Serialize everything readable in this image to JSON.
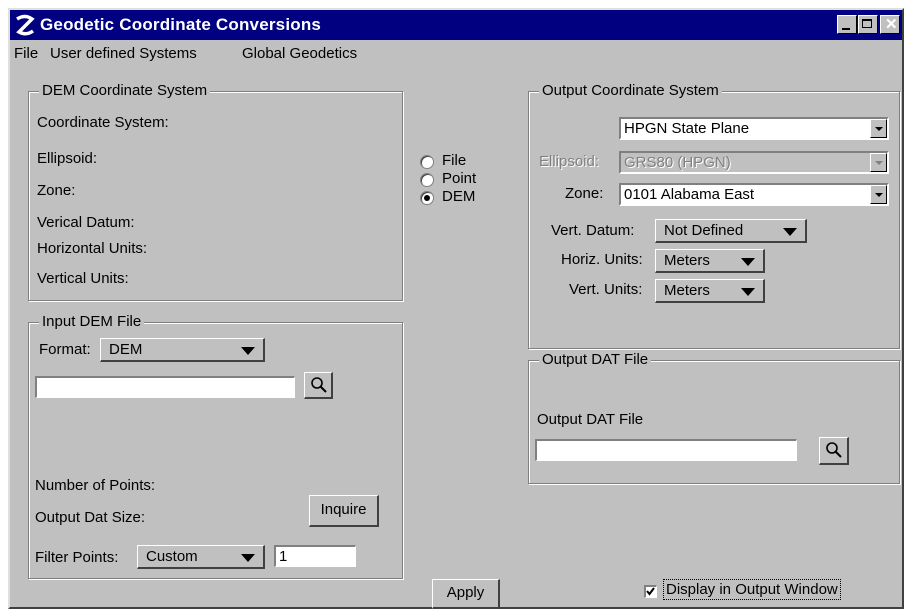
{
  "window": {
    "title": "Geodetic Coordinate Conversions"
  },
  "menu": [
    "File",
    "User defined Systems",
    "Global Geodetics"
  ],
  "dem_group": {
    "title": "DEM Coordinate System",
    "rows": [
      "Coordinate System:",
      "Ellipsoid:",
      "Zone:",
      "Verical Datum:",
      "Horizontal Units:",
      "Vertical Units:"
    ]
  },
  "input_group": {
    "title": "Input DEM File",
    "format_label": "Format:",
    "format_value": "DEM",
    "file_value": "",
    "num_points_label": "Number of Points:",
    "dat_size_label": "Output Dat Size:",
    "inquire_label": "Inquire",
    "filter_label": "Filter Points:",
    "filter_value": "Custom",
    "filter_input": "1"
  },
  "mode": {
    "options": [
      "File",
      "Point",
      "DEM"
    ],
    "selected": "DEM"
  },
  "output_group": {
    "title": "Output Coordinate System",
    "system_value": "HPGN State Plane",
    "ellipsoid_label": "Ellipsoid:",
    "ellipsoid_value": "GRS80 (HPGN)",
    "zone_label": "Zone:",
    "zone_value": "0101 Alabama East",
    "vdatum_label": "Vert. Datum:",
    "vdatum_value": "Not Defined",
    "hunits_label": "Horiz. Units:",
    "hunits_value": "Meters",
    "vunits_label": "Vert. Units:",
    "vunits_value": "Meters"
  },
  "output_dat_group": {
    "title": "Output DAT File",
    "field_label": "Output DAT File",
    "field_value": ""
  },
  "footer": {
    "apply_label": "Apply",
    "display_label": "Display in Output Window",
    "display_checked": true
  },
  "colors": {
    "titlebar": "#000080",
    "face": "#c0c0c0"
  }
}
